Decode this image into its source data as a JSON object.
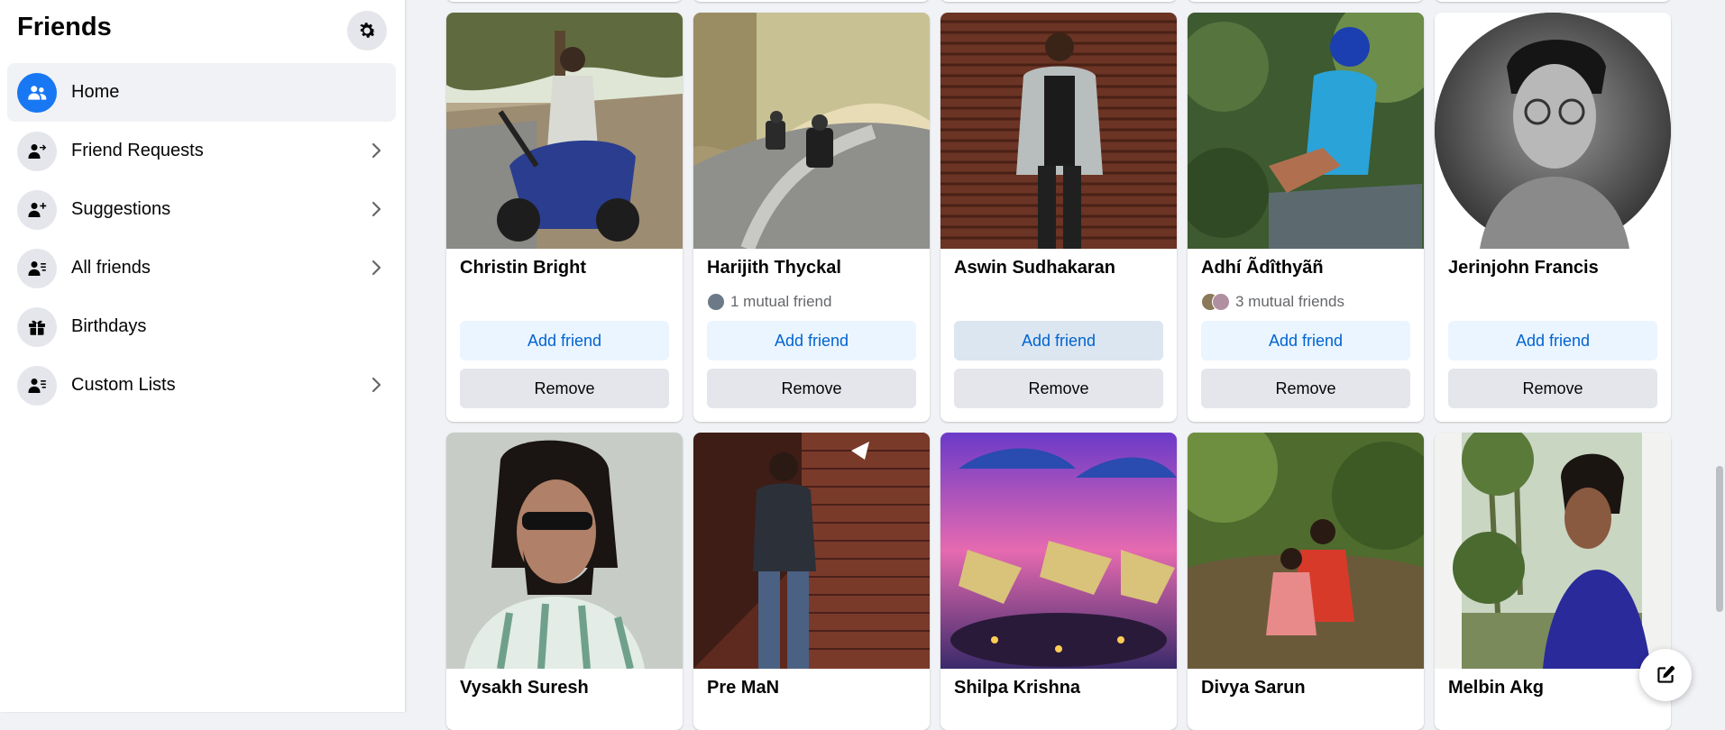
{
  "sidebar": {
    "title": "Friends",
    "settings_icon": "gear-icon",
    "items": [
      {
        "label": "Home",
        "icon": "friends-home-icon",
        "active": true,
        "has_chevron": false
      },
      {
        "label": "Friend Requests",
        "icon": "friend-request-icon",
        "active": false,
        "has_chevron": true
      },
      {
        "label": "Suggestions",
        "icon": "add-person-icon",
        "active": false,
        "has_chevron": true
      },
      {
        "label": "All friends",
        "icon": "friend-list-icon",
        "active": false,
        "has_chevron": true
      },
      {
        "label": "Birthdays",
        "icon": "gift-icon",
        "active": false,
        "has_chevron": false
      },
      {
        "label": "Custom Lists",
        "icon": "custom-list-icon",
        "active": false,
        "has_chevron": true
      }
    ]
  },
  "buttons": {
    "add_friend": "Add friend",
    "remove": "Remove"
  },
  "cards": [
    {
      "name": "Christin Bright",
      "mutual": ""
    },
    {
      "name": "Harijith Thyckal",
      "mutual": "1 mutual friend"
    },
    {
      "name": "Aswin Sudhakaran",
      "mutual": ""
    },
    {
      "name": "Adhí Ãdîthyãñ",
      "mutual": "3 mutual friends"
    },
    {
      "name": "Jerinjohn Francis",
      "mutual": ""
    },
    {
      "name": "Vysakh Suresh",
      "mutual": ""
    },
    {
      "name": "Pre MaN",
      "mutual": ""
    },
    {
      "name": "Shilpa Krishna",
      "mutual": ""
    },
    {
      "name": "Divya Sarun",
      "mutual": ""
    },
    {
      "name": "Melbin Akg",
      "mutual": ""
    }
  ],
  "colors": {
    "accent": "#1877f2",
    "add_button_bg": "#ebf5ff",
    "add_button_text": "#0064d1",
    "remove_button_bg": "#e4e6eb"
  },
  "floating": {
    "compose_icon": "compose-icon"
  }
}
